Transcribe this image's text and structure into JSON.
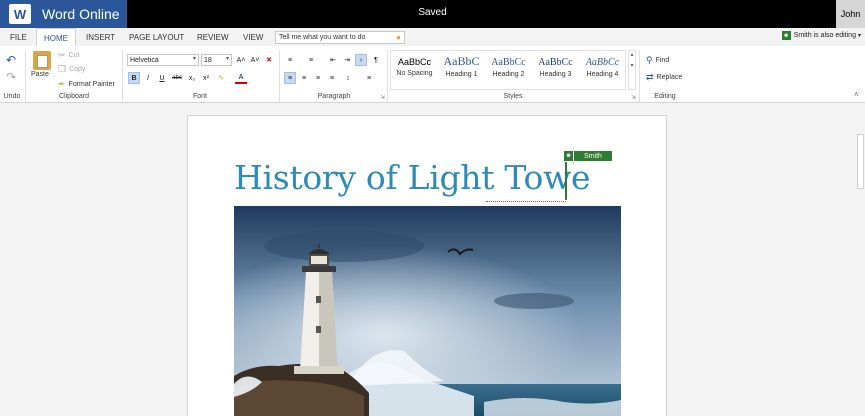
{
  "titlebar": {
    "logo_letter": "W",
    "app_name": "Word Online",
    "status": "Saved",
    "user": "John"
  },
  "tabs": [
    {
      "label": "FILE"
    },
    {
      "label": "HOME"
    },
    {
      "label": "INSERT"
    },
    {
      "label": "PAGE LAYOUT"
    },
    {
      "label": "REVIEW"
    },
    {
      "label": "VIEW"
    }
  ],
  "tellme": {
    "placeholder": "Tell me what you want to do"
  },
  "coedit": {
    "text": "Smith is also editing"
  },
  "ribbon": {
    "undo": {
      "label": "Undo"
    },
    "clipboard": {
      "paste": "Paste",
      "cut": "Cut",
      "copy": "Copy",
      "format_painter": "Format Painter",
      "label": "Clipboard"
    },
    "font": {
      "family": "Helvetica",
      "size": "18",
      "bold": "B",
      "italic": "I",
      "underline": "U",
      "strike": "abc",
      "subscript": "x₂",
      "superscript": "x²",
      "color_letter": "A",
      "grow": "A˄",
      "shrink": "A˅",
      "label": "Font"
    },
    "paragraph": {
      "label": "Paragraph"
    },
    "styles": {
      "items": [
        {
          "preview": "AaBbCc",
          "name": "No Spacing"
        },
        {
          "preview": "AaBbC",
          "name": "Heading 1"
        },
        {
          "preview": "AaBbCc",
          "name": "Heading 2"
        },
        {
          "preview": "AaBbCc",
          "name": "Heading 3"
        },
        {
          "preview": "AaBbCc",
          "name": "Heading 4"
        }
      ],
      "label": "Styles"
    },
    "editing": {
      "find": "Find",
      "replace": "Replace",
      "label": "Editing"
    }
  },
  "document": {
    "title": "History of Light Towe",
    "collaborator": "Smith"
  },
  "colors": {
    "brand": "#2b579a",
    "title_text": "#2e8bb7",
    "collaborator": "#2e7d32"
  }
}
